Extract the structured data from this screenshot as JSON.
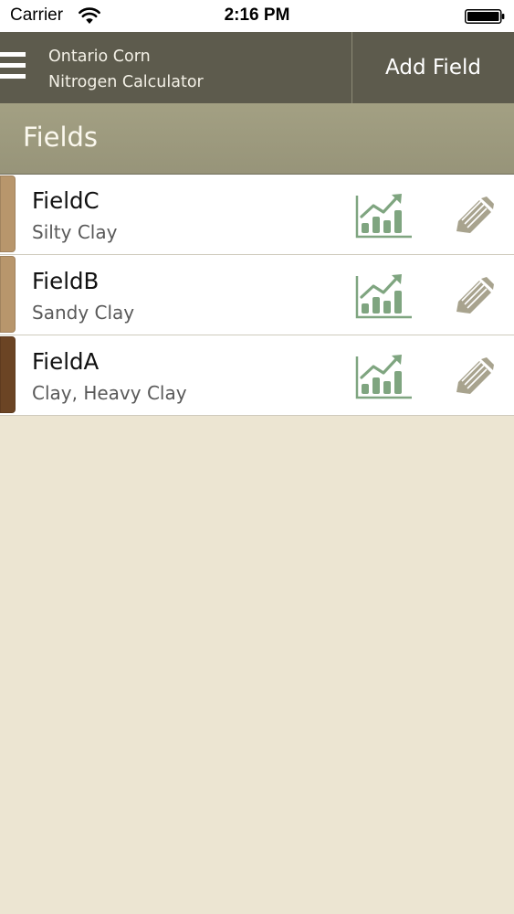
{
  "status_bar": {
    "carrier": "Carrier",
    "time": "2:16 PM",
    "icons": [
      "wifi-icon",
      "battery-icon"
    ]
  },
  "nav": {
    "menu_icon": "hamburger-menu-icon",
    "title_line1": "Ontario Corn",
    "title_line2": "Nitrogen Calculator",
    "add_field_label": "Add Field"
  },
  "section": {
    "title": "Fields"
  },
  "fields": [
    {
      "name": "FieldC",
      "soil": "Silty Clay",
      "swatch_color": "#b8966c"
    },
    {
      "name": "FieldB",
      "soil": "Sandy Clay",
      "swatch_color": "#b8966c"
    },
    {
      "name": "FieldA",
      "soil": "Clay, Heavy Clay",
      "swatch_color": "#6b4424"
    }
  ],
  "row_icons": [
    "bar-chart-icon",
    "pencil-edit-icon"
  ],
  "colors": {
    "nav_background": "#5d5b4d",
    "section_background": "#9e9b80",
    "page_background": "#ece5d2",
    "chart_icon_green": "#7fa580",
    "edit_icon_gray": "#a8a38e"
  }
}
